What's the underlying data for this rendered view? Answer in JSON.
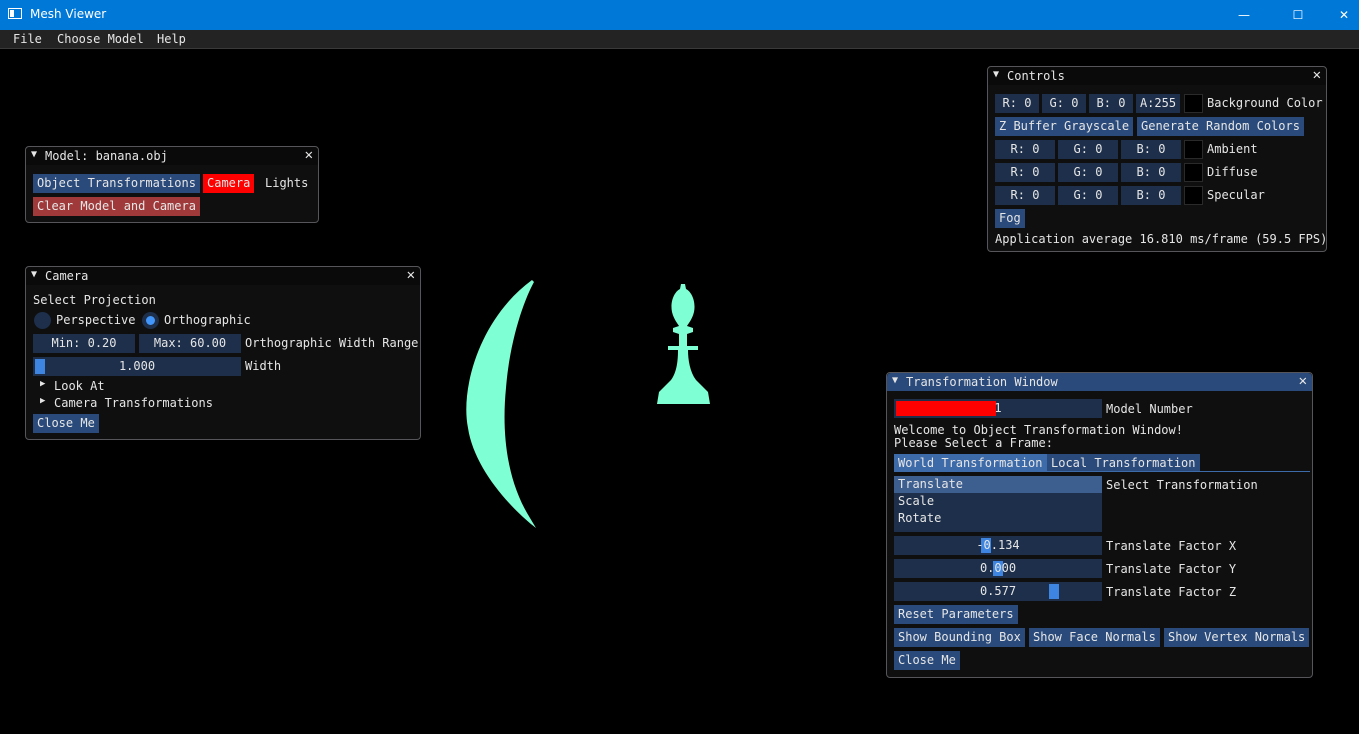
{
  "window": {
    "title": "Mesh Viewer",
    "minimize": "—",
    "maximize": "☐",
    "close": "✕"
  },
  "menu": [
    "File",
    "Choose Model",
    "Help"
  ],
  "colors": {
    "accent": "#294a7a",
    "mesh": "#7fffd4",
    "active_red": "#ff0000",
    "clear_red": "#a03a3a"
  },
  "model_window": {
    "title": "Model: banana.obj",
    "object_transformations": "Object Transformations",
    "camera": "Camera",
    "lights": "Lights",
    "clear": "Clear Model and Camera"
  },
  "camera_window": {
    "title": "Camera",
    "select_projection": "Select Projection",
    "perspective": "Perspective",
    "orthographic": "Orthographic",
    "selected_projection": "Orthographic",
    "min": "Min: 0.20",
    "max": "Max: 60.00",
    "range_label": "Orthographic Width Range",
    "width_value": "1.000",
    "width_fraction": 0.0,
    "width_label": "Width",
    "look_at": "Look At",
    "camera_transformations": "Camera Transformations",
    "close": "Close Me"
  },
  "controls_window": {
    "title": "Controls",
    "bg": {
      "r": "R:  0",
      "g": "G:  0",
      "b": "B:  0",
      "a": "A:255",
      "label": "Background Color"
    },
    "zbuffer": "Z Buffer Grayscale",
    "random_colors": "Generate Random Colors",
    "ambient": {
      "r": "R:  0",
      "g": "G:  0",
      "b": "B:  0",
      "label": "Ambient"
    },
    "diffuse": {
      "r": "R:  0",
      "g": "G:  0",
      "b": "B:  0",
      "label": "Diffuse"
    },
    "specular": {
      "r": "R:  0",
      "g": "G:  0",
      "b": "B:  0",
      "label": "Specular"
    },
    "fog": "Fog",
    "fps": "Application average 16.810 ms/frame (59.5 FPS)"
  },
  "transform_window": {
    "title": "Transformation Window",
    "model_number_value": "1",
    "model_number_label": "Model Number",
    "welcome": "Welcome to Object Transformation Window!",
    "select_frame": "Please Select a Frame:",
    "tab_world": "World Transformation",
    "tab_local": "Local Transformation",
    "list": [
      "Translate",
      "Scale",
      "Rotate"
    ],
    "selected": "Translate",
    "select_label": "Select Transformation",
    "tx_value": "-0.134",
    "ty_value": "0.000",
    "tz_value": "0.577",
    "tx_label": "Translate Factor X",
    "ty_label": "Translate Factor Y",
    "tz_label": "Translate Factor Z",
    "reset": "Reset Parameters",
    "bbox": "Show Bounding Box",
    "face_normals": "Show Face Normals",
    "vertex_normals": "Show Vertex Normals",
    "close": "Close Me"
  }
}
